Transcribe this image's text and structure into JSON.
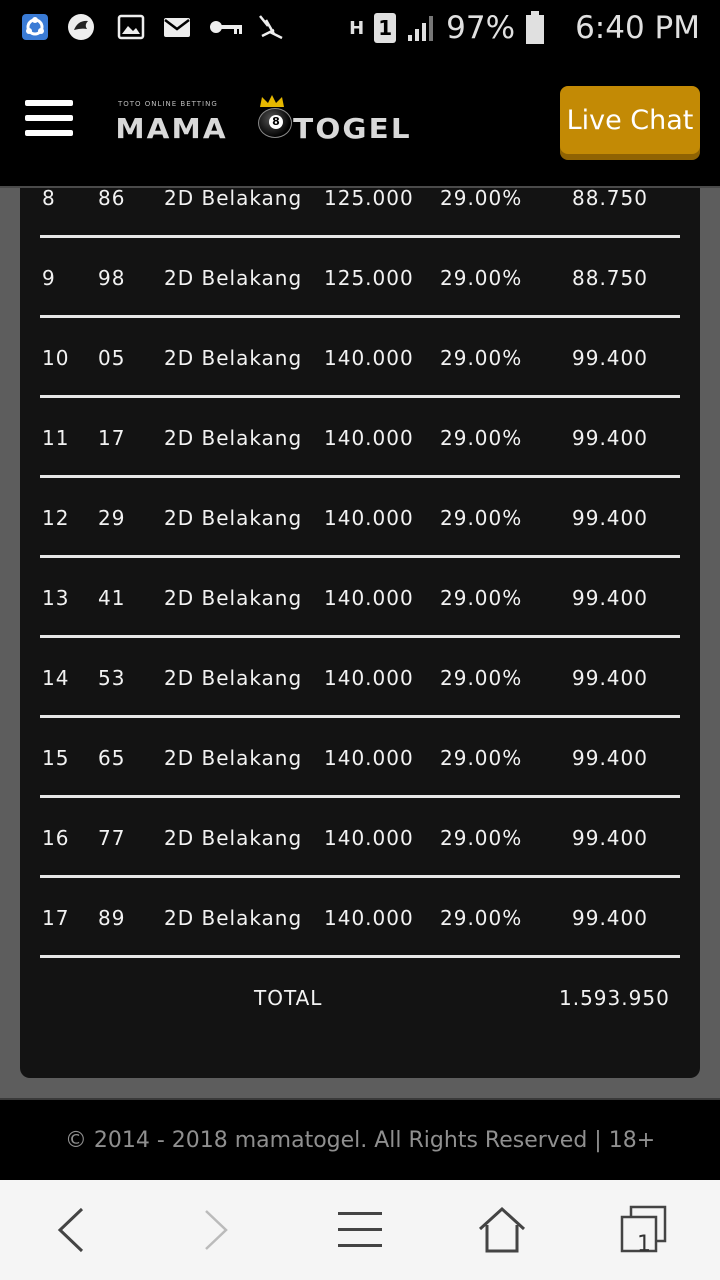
{
  "status_bar": {
    "battery_percent": "97%",
    "time": "6:40 PM",
    "sim_slot": "1",
    "network": "H",
    "icons": [
      "app-icon",
      "dragon-icon",
      "image-icon",
      "email-icon",
      "key-icon",
      "ant-icon",
      "signal-icon",
      "battery-icon"
    ]
  },
  "header": {
    "logo_tagline": "TOTO ONLINE BETTING",
    "logo_word_left": "MAMA",
    "logo_ball_number": "8",
    "logo_word_right": "TOGEL",
    "live_chat_label": "Live Chat",
    "accent_color": "#c38a05"
  },
  "table": {
    "rows": [
      {
        "no": "8",
        "number": "86",
        "type": "2D Belakang",
        "bet": "125.000",
        "discount": "29.00%",
        "pay": "88.750"
      },
      {
        "no": "9",
        "number": "98",
        "type": "2D Belakang",
        "bet": "125.000",
        "discount": "29.00%",
        "pay": "88.750"
      },
      {
        "no": "10",
        "number": "05",
        "type": "2D Belakang",
        "bet": "140.000",
        "discount": "29.00%",
        "pay": "99.400"
      },
      {
        "no": "11",
        "number": "17",
        "type": "2D Belakang",
        "bet": "140.000",
        "discount": "29.00%",
        "pay": "99.400"
      },
      {
        "no": "12",
        "number": "29",
        "type": "2D Belakang",
        "bet": "140.000",
        "discount": "29.00%",
        "pay": "99.400"
      },
      {
        "no": "13",
        "number": "41",
        "type": "2D Belakang",
        "bet": "140.000",
        "discount": "29.00%",
        "pay": "99.400"
      },
      {
        "no": "14",
        "number": "53",
        "type": "2D Belakang",
        "bet": "140.000",
        "discount": "29.00%",
        "pay": "99.400"
      },
      {
        "no": "15",
        "number": "65",
        "type": "2D Belakang",
        "bet": "140.000",
        "discount": "29.00%",
        "pay": "99.400"
      },
      {
        "no": "16",
        "number": "77",
        "type": "2D Belakang",
        "bet": "140.000",
        "discount": "29.00%",
        "pay": "99.400"
      },
      {
        "no": "17",
        "number": "89",
        "type": "2D Belakang",
        "bet": "140.000",
        "discount": "29.00%",
        "pay": "99.400"
      }
    ],
    "total_label": "TOTAL",
    "total_value": "1.593.950"
  },
  "footer": {
    "copyright": "© 2014 - 2018 mamatogel. All Rights Reserved | 18+"
  },
  "browser_nav": {
    "tab_count": "1",
    "icons": [
      "back-icon",
      "forward-icon",
      "menu-icon",
      "home-icon",
      "tabs-icon"
    ]
  }
}
